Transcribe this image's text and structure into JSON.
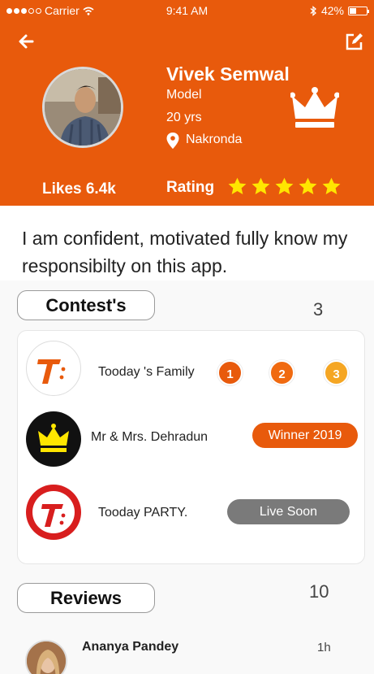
{
  "status_bar": {
    "carrier": "Carrier",
    "time": "9:41 AM",
    "battery": "42%",
    "battery_level": 0.42
  },
  "profile": {
    "name": "Vivek Semwal",
    "profession": "Model",
    "age": "20 yrs",
    "location": "Nakronda",
    "likes": "Likes 6.4k",
    "rating_label": "Rating",
    "rating_stars": 5,
    "bio": "I am confident, motivated fully know my responsibilty on this app."
  },
  "contests": {
    "title": "Contest's",
    "count": "3",
    "items": [
      {
        "name": "Tooday 's Family",
        "ranks": [
          "1",
          "2",
          "3"
        ]
      },
      {
        "name": "Mr & Mrs. Dehradun",
        "badge": "Winner 2019"
      },
      {
        "name": "Tooday PARTY.",
        "badge": "Live Soon"
      }
    ]
  },
  "reviews": {
    "title": "Reviews",
    "count": "10",
    "items": [
      {
        "name": "Ananya Pandey",
        "time": "1h"
      }
    ]
  },
  "colors": {
    "brand": "#e85a0c",
    "star": "#ffe600",
    "rank1": "#e85a0c",
    "rank2": "#f06a10",
    "rank3": "#f5a623",
    "live_soon": "#7a7a7a"
  }
}
